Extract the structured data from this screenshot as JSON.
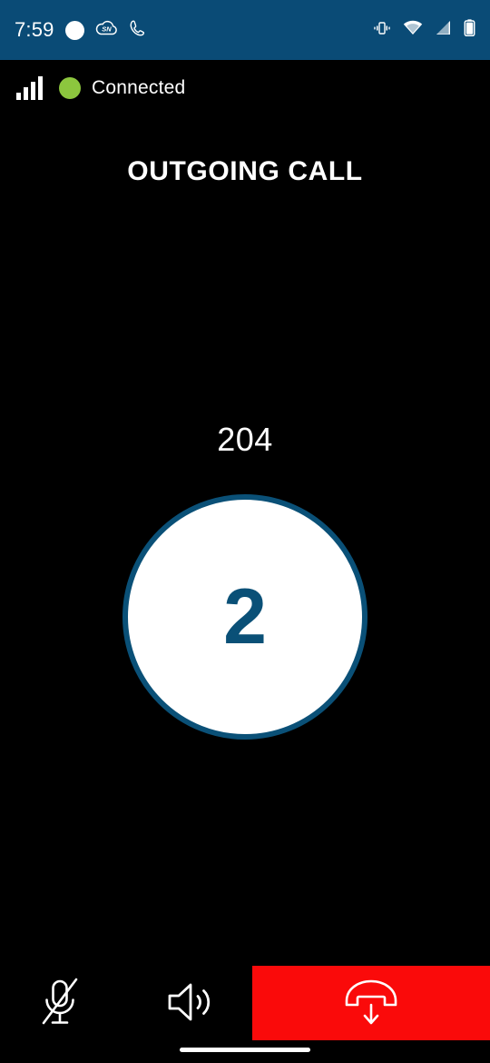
{
  "status_bar": {
    "time": "7:59",
    "left_icons": [
      {
        "name": "white-dot-icon",
        "label": "notification-dot"
      },
      {
        "name": "cloud-sn-icon",
        "label": "SN"
      },
      {
        "name": "phone-handset-icon",
        "label": "ongoing-call"
      }
    ],
    "right_icons": [
      {
        "name": "vibrate-icon",
        "label": "vibrate"
      },
      {
        "name": "wifi-icon",
        "label": "wifi"
      },
      {
        "name": "cellular-signal-icon",
        "label": "cellular"
      },
      {
        "name": "battery-icon",
        "label": "battery"
      }
    ],
    "background_color": "#0a4b76"
  },
  "connection": {
    "status_text": "Connected",
    "status_color": "#8cc63e",
    "signal_bars": 4
  },
  "call": {
    "title": "OUTGOING CALL",
    "number": "204",
    "avatar_initial": "2",
    "avatar_border_color": "#0a5077",
    "avatar_background": "#ffffff"
  },
  "controls": {
    "mute": {
      "label": "Mute",
      "icon": "microphone-off-icon",
      "active": true
    },
    "speaker": {
      "label": "Speaker",
      "icon": "speaker-icon",
      "active": false
    },
    "end_call": {
      "label": "End call",
      "icon": "hang-up-icon",
      "color": "#fa0a0a"
    }
  },
  "system": {
    "home_indicator": "home-indicator"
  }
}
